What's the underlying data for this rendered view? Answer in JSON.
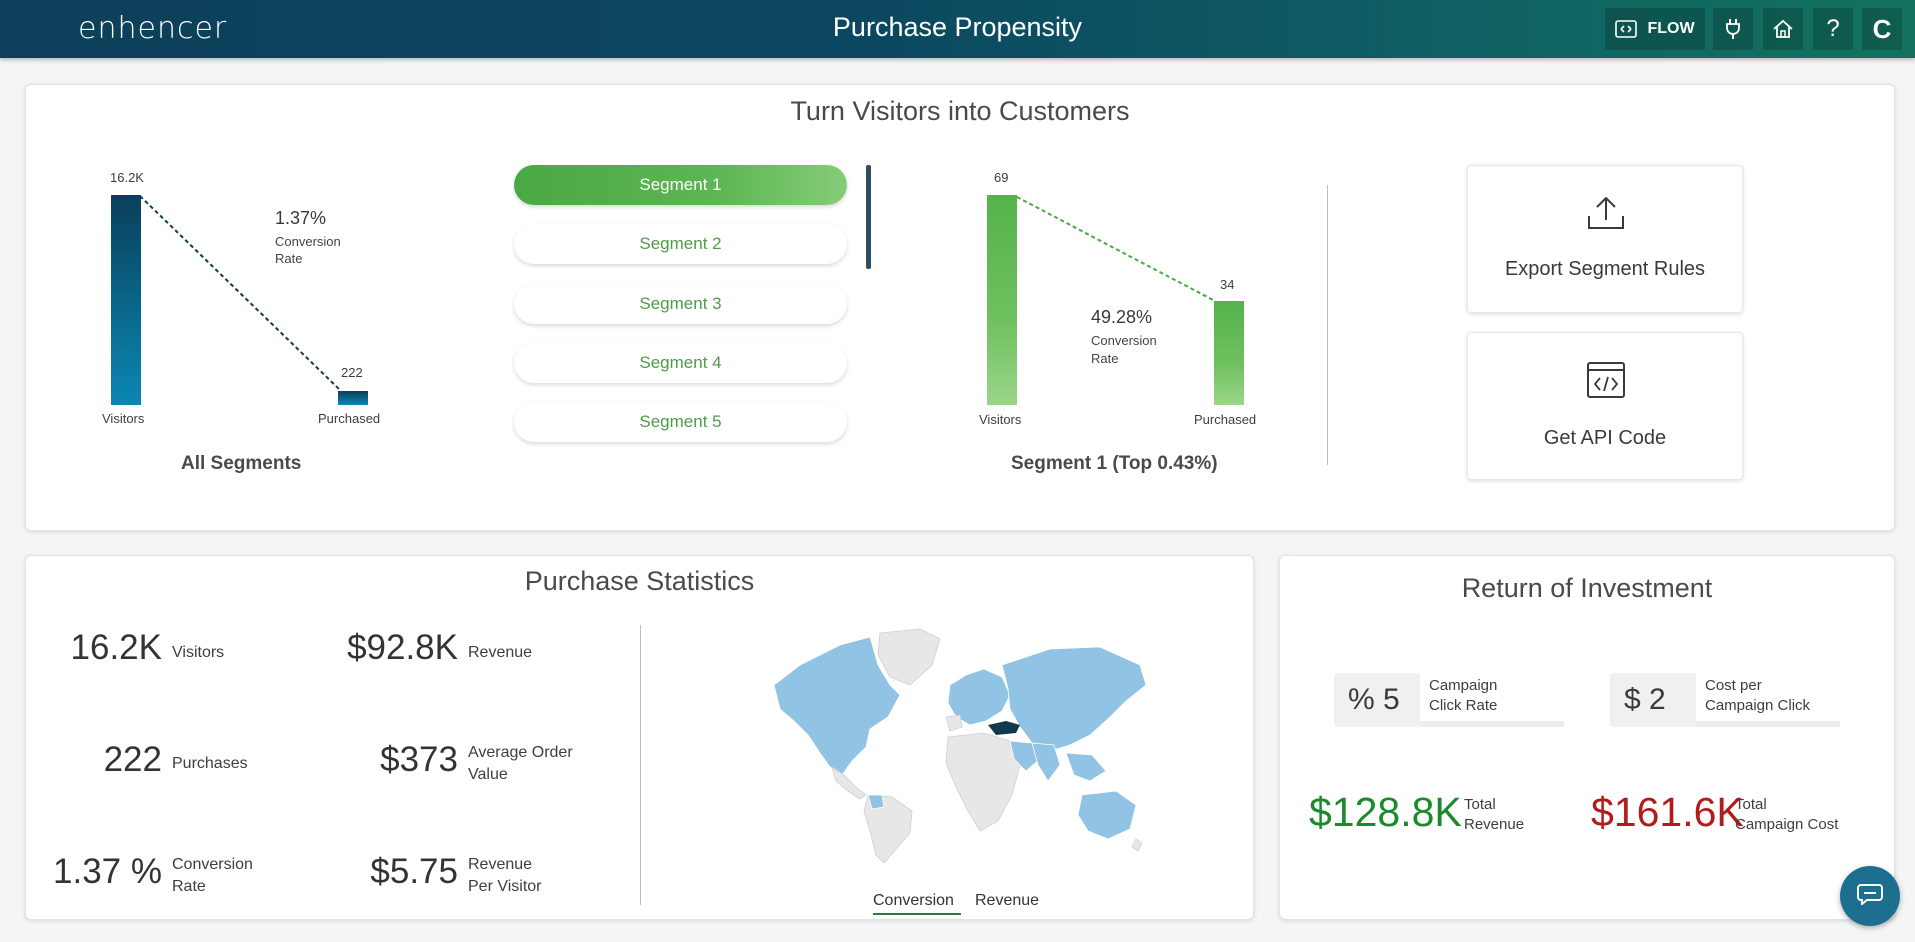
{
  "header": {
    "logo": "enhencer",
    "title": "Purchase Propensity",
    "flow_label": "FLOW",
    "help_label": "?",
    "user_initial": "C"
  },
  "funnel": {
    "title": "Turn Visitors into Customers",
    "all_segments": {
      "caption": "All Segments",
      "visitors_value": "16.2K",
      "purchased_value": "222",
      "visitors_label": "Visitors",
      "purchased_label": "Purchased",
      "conversion_pct": "1.37%",
      "conversion_label_1": "Conversion",
      "conversion_label_2": "Rate"
    },
    "segments": [
      "Segment 1",
      "Segment 2",
      "Segment 3",
      "Segment 4",
      "Segment 5"
    ],
    "selected_segment": {
      "caption": "Segment 1 (Top 0.43%)",
      "visitors_value": "69",
      "purchased_value": "34",
      "visitors_label": "Visitors",
      "purchased_label": "Purchased",
      "conversion_pct": "49.28%",
      "conversion_label_1": "Conversion",
      "conversion_label_2": "Rate"
    },
    "actions": {
      "export_label": "Export Segment Rules",
      "api_label": "Get API Code"
    },
    "colors": {
      "all_bars": "#0a5f82",
      "segment_bars": "#5cb651"
    }
  },
  "stats": {
    "title": "Purchase Statistics",
    "visitors_value": "16.2K",
    "visitors_label": "Visitors",
    "revenue_value": "$92.8K",
    "revenue_label": "Revenue",
    "purchases_value": "222",
    "purchases_label": "Purchases",
    "aov_value": "$373",
    "aov_label_1": "Average Order",
    "aov_label_2": "Value",
    "conv_value": "1.37 %",
    "conv_label_1": "Conversion",
    "conv_label_2": "Rate",
    "rpv_value": "$5.75",
    "rpv_label_1": "Revenue",
    "rpv_label_2": "Per Visitor",
    "tabs": [
      "Conversion",
      "Revenue"
    ],
    "active_tab": "Conversion",
    "map_colors": {
      "active": "#91c3e4",
      "inactive": "#e7e7e7",
      "highlight": "#0f3a4d"
    }
  },
  "roi": {
    "title": "Return of Investment",
    "click_rate_value": "% 5",
    "click_rate_label_1": "Campaign",
    "click_rate_label_2": "Click Rate",
    "cpc_value": "$ 2",
    "cpc_label_1": "Cost per",
    "cpc_label_2": "Campaign Click",
    "total_revenue_value": "$128.8K",
    "total_revenue_label_1": "Total",
    "total_revenue_label_2": "Revenue",
    "total_cost_value": "$161.6K",
    "total_cost_label_1": "Total",
    "total_cost_label_2": "Campaign Cost",
    "colors": {
      "revenue": "#1a8a2a",
      "cost": "#b11b1b"
    }
  }
}
